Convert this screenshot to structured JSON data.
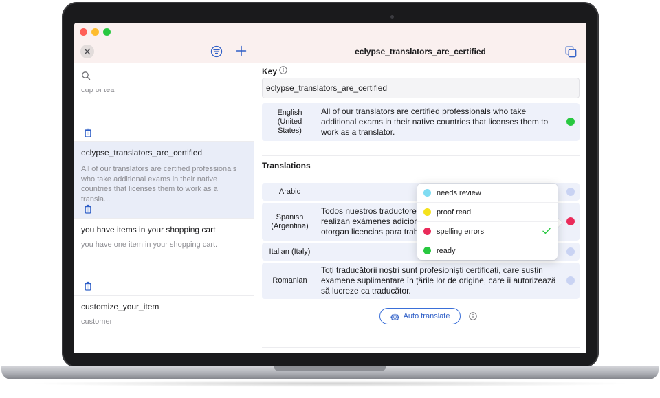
{
  "sidebar": {
    "search_placeholder": "",
    "items": [
      {
        "title": "",
        "description": "cup of tea"
      },
      {
        "title": "eclypse_translators_are_certified",
        "description": "All of our translators are certified professionals who take additional exams in their native countries that licenses them to work as a transla..."
      },
      {
        "title": "you have items in your shopping cart",
        "description": "you have one item in your shopping cart."
      },
      {
        "title": "customize_your_item",
        "description": "customer"
      }
    ]
  },
  "detail": {
    "title": "eclypse_translators_are_certified",
    "key_label": "Key",
    "key_value": "eclypse_translators_are_certified",
    "source": {
      "language": "English (United States)",
      "text": "All of our translators are certified professionals who take additional exams in their native countries that licenses them to work as a translator.",
      "status_color": "#28c840"
    },
    "translations_label": "Translations",
    "translations": [
      {
        "language": "Arabic",
        "text": "",
        "status_color": "#c9d3f3"
      },
      {
        "language": "Spanish (Argentina)",
        "text": "Todos nuestros traductores ... realizan exámenes adicionales ... otorgan licencias para traba...",
        "visible_text": [
          "Todos nuestros traductore",
          "realizan exámenes adicional",
          "otorgan licencias para traba"
        ],
        "status_color": "#ea2b5a"
      },
      {
        "language": "Italian (Italy)",
        "text": "",
        "status_color": "#c9d3f3"
      },
      {
        "language": "Romanian",
        "text": "Toți traducătorii noștri sunt profesioniști certificați, care susțin examene suplimentare în țările lor de origine, care îi autorizează să lucreze ca traducător.",
        "status_color": "#c9d3f3"
      }
    ],
    "auto_translate_label": "Auto translate"
  },
  "status_menu": {
    "options": [
      {
        "label": "needs review",
        "color": "#7fdcf2"
      },
      {
        "label": "proof read",
        "color": "#f5e21b"
      },
      {
        "label": "spelling errors",
        "color": "#ea2b5a",
        "selected": true
      },
      {
        "label": "ready",
        "color": "#28c840"
      }
    ]
  }
}
